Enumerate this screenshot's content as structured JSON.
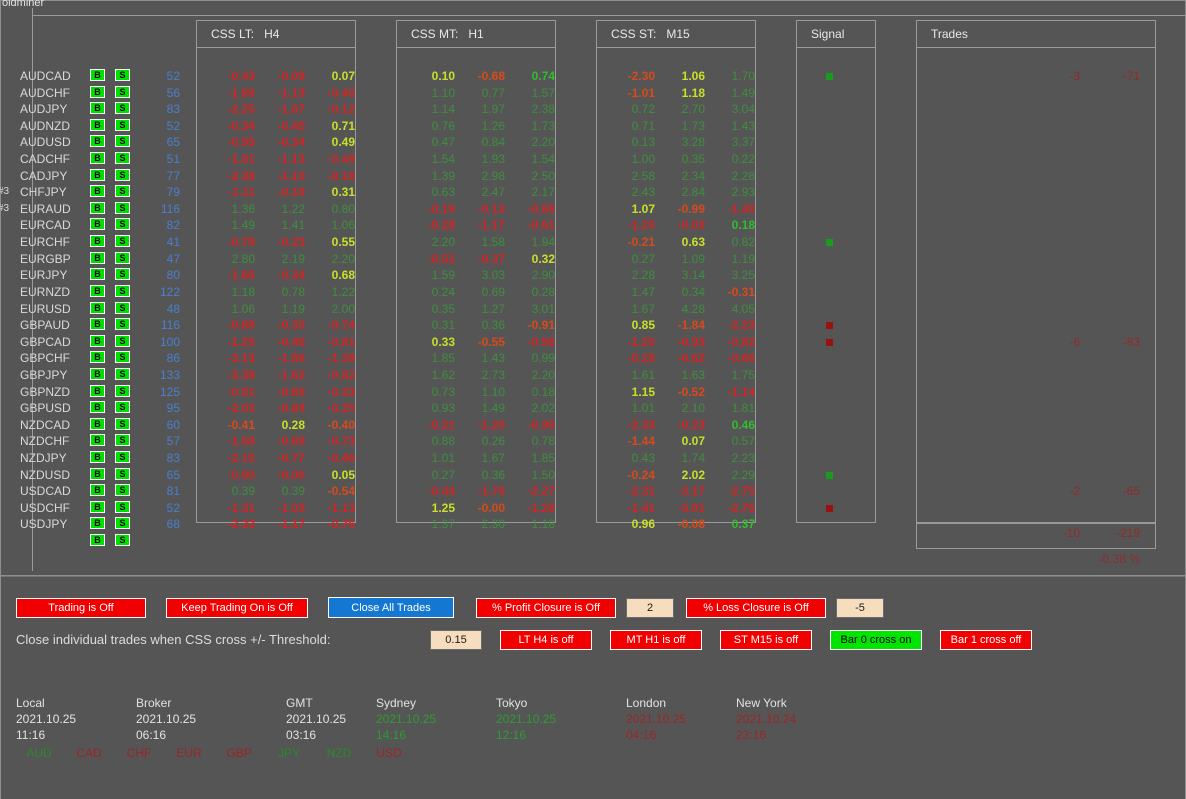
{
  "window": {
    "title": "oldminer"
  },
  "left_tags": {
    "chfjpy": "#3",
    "euraud": "#3"
  },
  "headers": {
    "css_lt": "CSS LT:   H4",
    "css_mt": "CSS MT:   H1",
    "css_st": "CSS ST:   M15",
    "signal": "Signal",
    "trades": "Trades"
  },
  "pairs": [
    "AUDCAD",
    "AUDCHF",
    "AUDJPY",
    "AUDNZD",
    "AUDUSD",
    "CADCHF",
    "CADJPY",
    "CHFJPY",
    "EURAUD",
    "EURCAD",
    "EURCHF",
    "EURGBP",
    "EURJPY",
    "EURNZD",
    "EURUSD",
    "GBPAUD",
    "GBPCAD",
    "GBPCHF",
    "GBPJPY",
    "GBPNZD",
    "GBPUSD",
    "NZDCAD",
    "NZDCHF",
    "NZDJPY",
    "NZDUSD",
    "USDCAD",
    "USDCHF",
    "USDJPY"
  ],
  "buttons": {
    "buy_label": "B",
    "sell_label": "S"
  },
  "spread": [
    52,
    56,
    83,
    52,
    65,
    51,
    77,
    79,
    116,
    82,
    41,
    47,
    80,
    122,
    48,
    116,
    100,
    86,
    133,
    125,
    95,
    60,
    57,
    83,
    65,
    81,
    52,
    68
  ],
  "css_lt": [
    [
      -0.43,
      -0.09,
      0.07
    ],
    [
      -1.8,
      -1.13,
      -0.4
    ],
    [
      -2.25,
      -1.07,
      -0.12
    ],
    [
      -0.34,
      -0.45,
      0.71
    ],
    [
      -0.95,
      -0.34,
      0.49
    ],
    [
      -1.81,
      -1.13,
      -0.49
    ],
    [
      -2.38,
      -1.1,
      -0.18
    ],
    [
      -1.11,
      -0.19,
      0.31
    ],
    [
      1.36,
      1.22,
      0.8
    ],
    [
      1.49,
      1.41,
      1.06
    ],
    [
      -0.79,
      -0.23,
      0.55
    ],
    [
      2.8,
      2.19,
      2.2
    ],
    [
      -1.66,
      -0.34,
      0.68
    ],
    [
      1.18,
      0.78,
      1.22
    ],
    [
      1.06,
      1.19,
      2.0
    ],
    [
      -0.89,
      -0.3,
      -0.74
    ],
    [
      -1.25,
      -0.49,
      -0.81
    ],
    [
      -3.13,
      -1.86,
      -1.38
    ],
    [
      -3.38,
      -1.62,
      -0.82
    ],
    [
      -0.91,
      -0.65,
      -0.23
    ],
    [
      -2.03,
      -0.84,
      -0.25
    ],
    [
      -0.41,
      0.28,
      -0.4
    ],
    [
      -1.58,
      -0.68,
      -0.73
    ],
    [
      -2.15,
      -0.77,
      -0.46
    ],
    [
      -0.9,
      -0.0,
      0.05
    ],
    [
      0.39,
      0.39,
      -0.54
    ],
    [
      -1.31,
      -1.03,
      -1.13
    ],
    [
      -2.33,
      -1.17,
      -0.76
    ]
  ],
  "css_lt_style": [
    [
      "neg-str",
      "neg-str",
      "pos-hl"
    ],
    [
      "neg-str",
      "neg-str",
      "neg-str"
    ],
    [
      "neg-str",
      "neg-str",
      "neg-str"
    ],
    [
      "neg-str",
      "neg-str",
      "pos-hl"
    ],
    [
      "neg-str",
      "neg-str",
      "pos-hl"
    ],
    [
      "neg-str",
      "neg-str",
      "neg-str"
    ],
    [
      "neg-str",
      "neg-str",
      "neg-str"
    ],
    [
      "neg-str",
      "neg-str",
      "pos-hl"
    ],
    [
      "pos",
      "pos",
      "pos"
    ],
    [
      "pos",
      "pos",
      "pos"
    ],
    [
      "neg-str",
      "neg-str",
      "pos-hl"
    ],
    [
      "pos",
      "pos",
      "pos"
    ],
    [
      "neg-str",
      "neg-str",
      "pos-hl"
    ],
    [
      "pos",
      "pos",
      "pos"
    ],
    [
      "pos",
      "pos",
      "pos"
    ],
    [
      "neg-str",
      "neg-str",
      "neg-str"
    ],
    [
      "neg-str",
      "neg-str",
      "neg-str"
    ],
    [
      "neg-str",
      "neg-str",
      "neg-str"
    ],
    [
      "neg-str",
      "neg-str",
      "neg-str"
    ],
    [
      "neg-str",
      "neg-str",
      "neg-str"
    ],
    [
      "neg-str",
      "neg-str",
      "neg-str"
    ],
    [
      "neg-hl",
      "pos-hl",
      "neg-hl"
    ],
    [
      "neg-str",
      "neg-str",
      "neg-str"
    ],
    [
      "neg-str",
      "neg-str",
      "neg-str"
    ],
    [
      "neg-str",
      "neg-str",
      "pos-hl"
    ],
    [
      "pos",
      "pos",
      "neg-hl"
    ],
    [
      "neg-str",
      "neg-str",
      "neg-str"
    ],
    [
      "neg-str",
      "neg-str",
      "neg-str"
    ]
  ],
  "css_mt": [
    [
      0.1,
      -0.68,
      0.74
    ],
    [
      1.1,
      0.77,
      1.57
    ],
    [
      1.14,
      1.97,
      2.38
    ],
    [
      0.76,
      1.26,
      1.73
    ],
    [
      0.47,
      0.84,
      2.2
    ],
    [
      1.54,
      1.93,
      1.54
    ],
    [
      1.39,
      2.98,
      2.5
    ],
    [
      0.63,
      2.47,
      2.17
    ],
    [
      -0.19,
      -0.13,
      -0.88
    ],
    [
      -0.28,
      -1.17,
      -0.51
    ],
    [
      2.2,
      1.58,
      1.94
    ],
    [
      -0.52,
      -0.37,
      0.32
    ],
    [
      1.59,
      3.03,
      2.9
    ],
    [
      0.24,
      0.69,
      0.28
    ],
    [
      0.35,
      1.27,
      3.01
    ],
    [
      0.31,
      0.36,
      -0.91
    ],
    [
      0.33,
      -0.55,
      -0.56
    ],
    [
      1.85,
      1.43,
      0.99
    ],
    [
      1.62,
      2.73,
      2.2
    ],
    [
      0.73,
      1.1,
      0.18
    ],
    [
      0.93,
      1.49,
      2.02
    ],
    [
      -0.21,
      -1.2,
      -0.3
    ],
    [
      0.88,
      0.26,
      0.78
    ],
    [
      1.01,
      1.67,
      1.85
    ],
    [
      0.27,
      0.36,
      1.5
    ],
    [
      -0.44,
      -1.76,
      -2.27
    ],
    [
      1.25,
      -0.0,
      -1.28
    ],
    [
      1.37,
      2.3,
      1.18
    ]
  ],
  "css_mt_style": [
    [
      "pos-hl",
      "neg-hl",
      "pos-str"
    ],
    [
      "pos",
      "pos",
      "pos"
    ],
    [
      "pos",
      "pos",
      "pos"
    ],
    [
      "pos",
      "pos",
      "pos"
    ],
    [
      "pos",
      "pos",
      "pos"
    ],
    [
      "pos",
      "pos",
      "pos"
    ],
    [
      "pos",
      "pos",
      "pos"
    ],
    [
      "pos",
      "pos",
      "pos"
    ],
    [
      "neg-str",
      "neg-str",
      "neg-str"
    ],
    [
      "neg-str",
      "neg-str",
      "neg-str"
    ],
    [
      "pos",
      "pos",
      "pos"
    ],
    [
      "neg-str",
      "neg-str",
      "pos-hl"
    ],
    [
      "pos",
      "pos",
      "pos"
    ],
    [
      "pos",
      "pos",
      "pos"
    ],
    [
      "pos",
      "pos",
      "pos"
    ],
    [
      "pos",
      "pos",
      "neg-hl"
    ],
    [
      "pos-hl",
      "neg-hl",
      "neg-str"
    ],
    [
      "pos",
      "pos",
      "pos"
    ],
    [
      "pos",
      "pos",
      "pos"
    ],
    [
      "pos",
      "pos",
      "pos"
    ],
    [
      "pos",
      "pos",
      "pos"
    ],
    [
      "neg-str",
      "neg-str",
      "neg-str"
    ],
    [
      "pos",
      "pos",
      "pos"
    ],
    [
      "pos",
      "pos",
      "pos"
    ],
    [
      "pos",
      "pos",
      "pos"
    ],
    [
      "neg-str",
      "neg-str",
      "neg-str"
    ],
    [
      "pos-hl",
      "neg-hl",
      "neg-str"
    ],
    [
      "pos",
      "pos",
      "pos"
    ]
  ],
  "css_st": [
    [
      -2.3,
      1.06,
      1.7
    ],
    [
      -1.01,
      1.18,
      1.49
    ],
    [
      0.72,
      2.7,
      3.04
    ],
    [
      0.71,
      1.73,
      1.43
    ],
    [
      0.13,
      3.28,
      3.37
    ],
    [
      1.0,
      0.35,
      0.22
    ],
    [
      2.58,
      2.34,
      2.28
    ],
    [
      2.43,
      2.84,
      2.93
    ],
    [
      1.07,
      -0.99,
      -1.4
    ],
    [
      -1.23,
      -0.03,
      0.18
    ],
    [
      -0.21,
      0.63,
      0.82
    ],
    [
      0.27,
      1.09,
      1.19
    ],
    [
      2.28,
      3.14,
      3.25
    ],
    [
      1.47,
      0.34,
      -0.31
    ],
    [
      1.67,
      4.28,
      4.05
    ],
    [
      0.85,
      -1.84,
      -2.23
    ],
    [
      -1.2,
      -0.93,
      -0.82
    ],
    [
      -0.28,
      -0.62,
      -0.66
    ],
    [
      1.61,
      1.63,
      1.75
    ],
    [
      1.15,
      -0.52,
      -1.14
    ],
    [
      1.01,
      2.1,
      1.81
    ],
    [
      -2.33,
      -0.23,
      0.46
    ],
    [
      -1.44,
      0.07,
      0.57
    ],
    [
      0.43,
      1.74,
      2.23
    ],
    [
      -0.24,
      2.02,
      2.29
    ],
    [
      -2.31,
      -3.17,
      -2.75
    ],
    [
      -1.41,
      -3.01,
      -2.76
    ],
    [
      0.96,
      -0.08,
      0.37
    ]
  ],
  "css_st_style": [
    [
      "neg-hl",
      "pos-hl",
      "pos"
    ],
    [
      "neg-hl",
      "pos-hl",
      "pos"
    ],
    [
      "pos",
      "pos",
      "pos"
    ],
    [
      "pos",
      "pos",
      "pos"
    ],
    [
      "pos",
      "pos",
      "pos"
    ],
    [
      "pos",
      "pos",
      "pos"
    ],
    [
      "pos",
      "pos",
      "pos"
    ],
    [
      "pos",
      "pos",
      "pos"
    ],
    [
      "pos-hl",
      "neg-hl",
      "neg-str"
    ],
    [
      "neg-str",
      "neg-str",
      "pos-str"
    ],
    [
      "neg-hl",
      "pos-hl",
      "pos"
    ],
    [
      "pos",
      "pos",
      "pos"
    ],
    [
      "pos",
      "pos",
      "pos"
    ],
    [
      "pos",
      "pos",
      "neg-hl"
    ],
    [
      "pos",
      "pos",
      "pos"
    ],
    [
      "pos-hl",
      "neg-hl",
      "neg-str"
    ],
    [
      "neg-str",
      "neg-str",
      "neg-str"
    ],
    [
      "neg-str",
      "neg-str",
      "neg-str"
    ],
    [
      "pos",
      "pos",
      "pos"
    ],
    [
      "pos-hl",
      "neg-hl",
      "neg-str"
    ],
    [
      "pos",
      "pos",
      "pos"
    ],
    [
      "neg-str",
      "neg-str",
      "pos-str"
    ],
    [
      "neg-hl",
      "pos-hl",
      "pos"
    ],
    [
      "pos",
      "pos",
      "pos"
    ],
    [
      "neg-hl",
      "pos-hl",
      "pos"
    ],
    [
      "neg-str",
      "neg-str",
      "neg-str"
    ],
    [
      "neg-str",
      "neg-str",
      "neg-str"
    ],
    [
      "pos-hl",
      "neg-hl",
      "pos-str"
    ]
  ],
  "signals": [
    {
      "row": 0,
      "color": "green"
    },
    {
      "row": 10,
      "color": "green"
    },
    {
      "row": 15,
      "color": "red"
    },
    {
      "row": 16,
      "color": "red"
    },
    {
      "row": 24,
      "color": "green"
    },
    {
      "row": 26,
      "color": "red"
    }
  ],
  "trades_rows": [
    {
      "row": 0,
      "pips": "-3",
      "amount": "-71"
    },
    {
      "row": 16,
      "pips": "-6",
      "amount": "-83"
    },
    {
      "row": 25,
      "pips": "-2",
      "amount": "-65"
    }
  ],
  "trades_total": {
    "pips": "-10",
    "amount": "-219",
    "percent": "-0.38 %"
  },
  "controls": {
    "trading": "Trading is Off",
    "keep_trading": "Keep Trading On is Off",
    "close_all": "Close All Trades",
    "profit_closure": "% Profit Closure is Off",
    "profit_value": "2",
    "loss_closure": "% Loss Closure is Off",
    "loss_value": "-5",
    "threshold_label": "Close individual trades when CSS cross +/- Threshold:",
    "threshold_value": "0.15",
    "lt_h4": "LT  H4 is off",
    "mt_h1": "MT  H1 is off",
    "st_m15": "ST  M15 is off",
    "bar0": "Bar 0 cross on",
    "bar1": "Bar 1 cross off"
  },
  "clocks": [
    {
      "name": "Local",
      "date": "2021.10.25",
      "time": "11:16",
      "style": "c-white"
    },
    {
      "name": "Broker",
      "date": "2021.10.25",
      "time": "06:16",
      "style": "c-white"
    },
    {
      "name": "GMT",
      "date": "2021.10.25",
      "time": "03:16",
      "style": "c-white"
    },
    {
      "name": "Sydney",
      "date": "2021.10.25",
      "time": "14:16",
      "style": "c-green"
    },
    {
      "name": "Tokyo",
      "date": "2021.10.25",
      "time": "12:16",
      "style": "c-green"
    },
    {
      "name": "London",
      "date": "2021.10.25",
      "time": "04:16",
      "style": "c-red"
    },
    {
      "name": "New York",
      "date": "2021.10.24",
      "time": "23:16",
      "style": "c-red"
    }
  ],
  "currencies": [
    {
      "code": "AUD",
      "style": "ccy-g"
    },
    {
      "code": "CAD",
      "style": "ccy-r"
    },
    {
      "code": "CHF",
      "style": "ccy-r"
    },
    {
      "code": "EUR",
      "style": "ccy-r"
    },
    {
      "code": "GBP",
      "style": "ccy-r"
    },
    {
      "code": "JPY",
      "style": "ccy-g"
    },
    {
      "code": "NZD",
      "style": "ccy-g"
    },
    {
      "code": "USD",
      "style": "ccy-r"
    }
  ],
  "colors": {
    "background": "#555555",
    "border": "#9a9a9a",
    "buy_sell_green": "#00e000",
    "button_red": "#f20000",
    "button_blue": "#1478d2",
    "button_green": "#00e400",
    "field_cream": "#f6ddbd",
    "spread_blue": "#4a7fcf"
  }
}
